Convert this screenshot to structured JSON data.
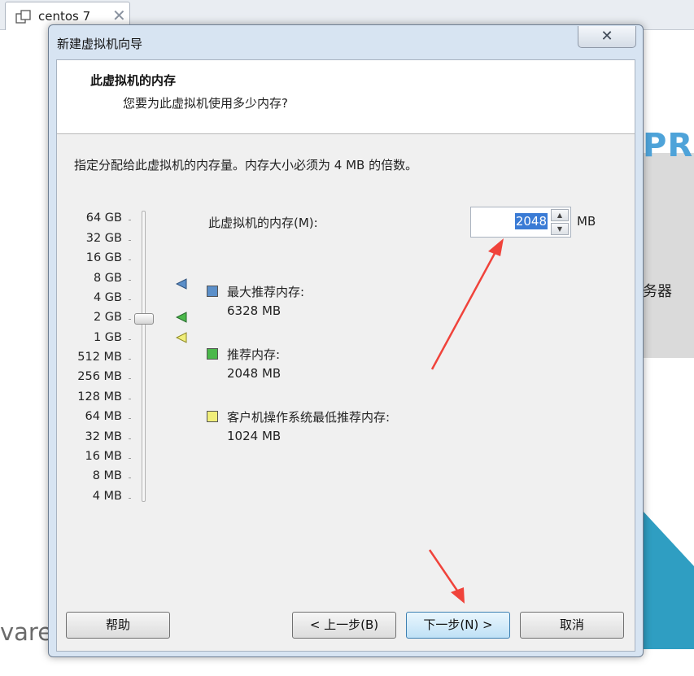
{
  "tab": {
    "title": "centos  7",
    "close": "✕"
  },
  "background": {
    "pr_text": "PR",
    "server_text": "务器",
    "vmware_text": "vare"
  },
  "dialog": {
    "title": "新建虚拟机向导",
    "close": "✕",
    "header_title": "此虚拟机的内存",
    "header_subtitle": "您要为此虚拟机使用多少内存?",
    "instruction": "指定分配给此虚拟机的内存量。内存大小必须为 4 MB 的倍数。",
    "memory_label": "此虚拟机的内存(M):",
    "memory_value": "2048",
    "memory_unit": "MB",
    "scale": [
      "64 GB",
      "32 GB",
      "16 GB",
      "8 GB",
      "4 GB",
      "2 GB",
      "1 GB",
      "512 MB",
      "256 MB",
      "128 MB",
      "64 MB",
      "32 MB",
      "16 MB",
      "8 MB",
      "4 MB"
    ],
    "recommendations": [
      {
        "label": "最大推荐内存:",
        "value": "6328 MB",
        "color": "#5b8fc9"
      },
      {
        "label": "推荐内存:",
        "value": "2048 MB",
        "color": "#4bb84b"
      },
      {
        "label": "客户机操作系统最低推荐内存:",
        "value": "1024 MB",
        "color": "#f0ee7a"
      }
    ],
    "buttons": {
      "help": "帮助",
      "back": "< 上一步(B)",
      "next": "下一步(N) >",
      "cancel": "取消"
    }
  },
  "colors": {
    "annotation_arrow": "#f0433b",
    "selection": "#3a7bd5"
  }
}
